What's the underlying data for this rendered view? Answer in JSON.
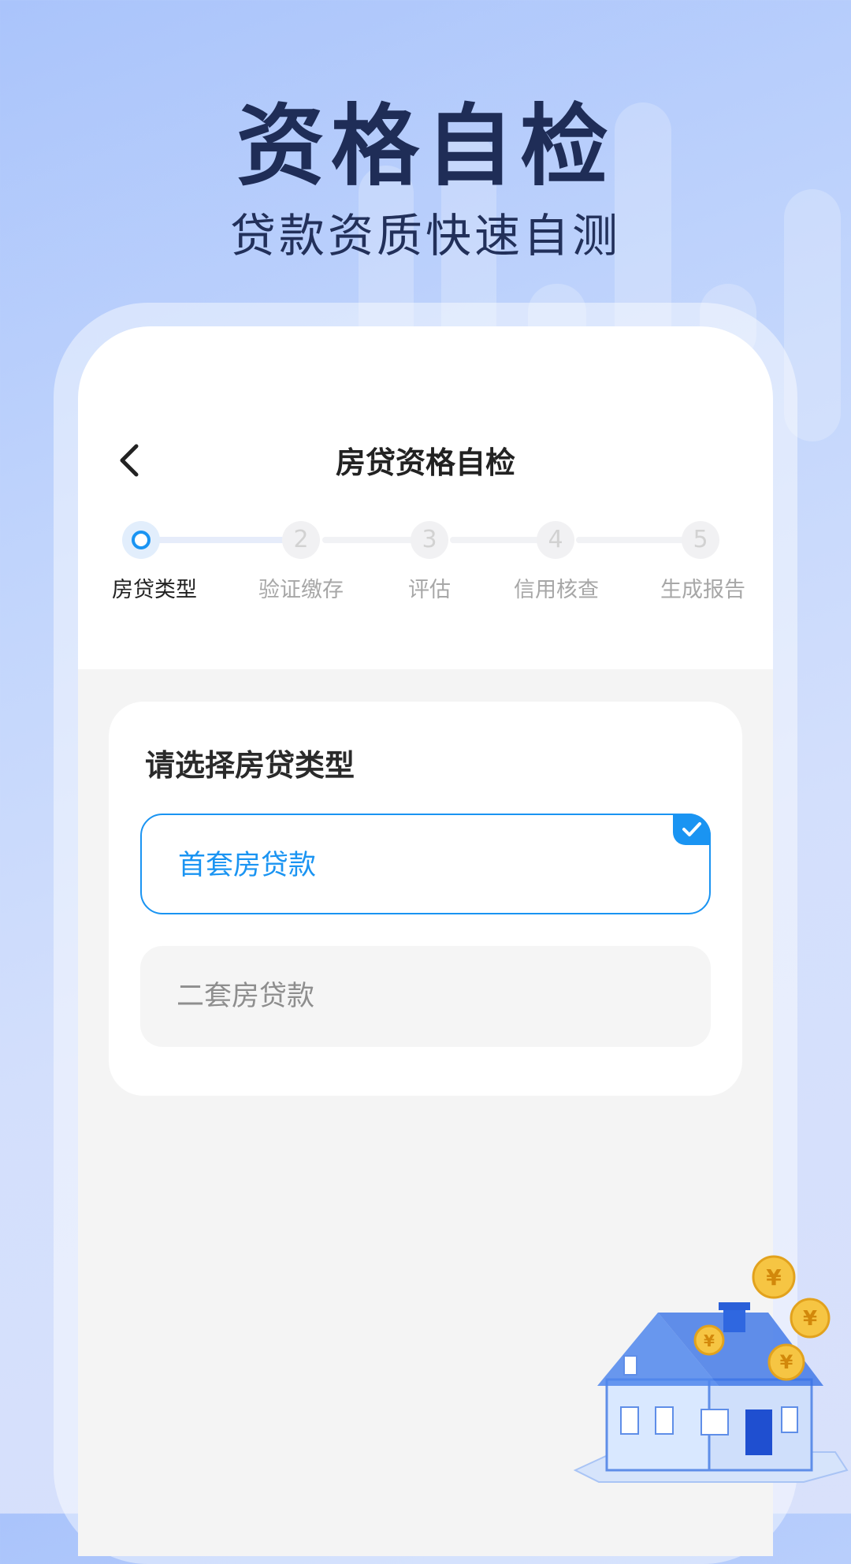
{
  "hero": {
    "title": "资格自检",
    "subtitle": "贷款资质快速自测"
  },
  "screen": {
    "nav_title": "房贷资格自检",
    "steps": [
      {
        "label": "房贷类型",
        "number": "1",
        "state": "active"
      },
      {
        "label": "验证缴存",
        "number": "2",
        "state": "inactive"
      },
      {
        "label": "评估",
        "number": "3",
        "state": "inactive"
      },
      {
        "label": "信用核查",
        "number": "4",
        "state": "inactive"
      },
      {
        "label": "生成报告",
        "number": "5",
        "state": "inactive"
      }
    ],
    "card": {
      "title": "请选择房贷类型",
      "options": [
        {
          "label": "首套房贷款",
          "selected": true
        },
        {
          "label": "二套房贷款",
          "selected": false
        }
      ]
    }
  },
  "icons": {
    "back": "chevron-left-icon",
    "check": "checkmark-icon",
    "illustration": "house-coins-illustration"
  },
  "colors": {
    "accent": "#1a94f2",
    "hero_text": "#1f2d57",
    "selected_border": "#1a94f2"
  }
}
